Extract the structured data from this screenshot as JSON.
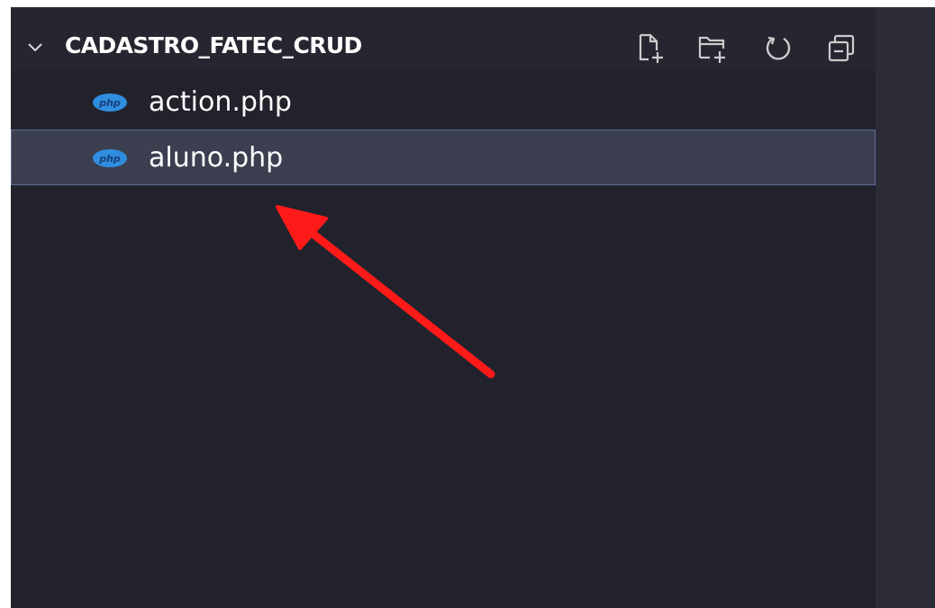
{
  "explorer": {
    "folder_name": "CADASTRO_FATEC_CRUD",
    "actions": [
      {
        "name": "new-file-icon",
        "label": "New File"
      },
      {
        "name": "new-folder-icon",
        "label": "New Folder"
      },
      {
        "name": "refresh-icon",
        "label": "Refresh Explorer"
      },
      {
        "name": "collapse-all-icon",
        "label": "Collapse Folders in Explorer"
      }
    ],
    "files": [
      {
        "name": "action.php",
        "icon": "php-file-icon",
        "selected": false
      },
      {
        "name": "aluno.php",
        "icon": "php-file-icon",
        "selected": true
      }
    ]
  },
  "annotation": {
    "type": "arrow",
    "color": "#ff1a1a",
    "points_to": "aluno.php"
  },
  "colors": {
    "sidebar_bg": "#21222b",
    "header_bg": "#252630",
    "selection_bg": "#3c3f50",
    "selection_border": "#5c6a9c",
    "php_icon": "#2f8ee0",
    "text": "#ffffff"
  }
}
